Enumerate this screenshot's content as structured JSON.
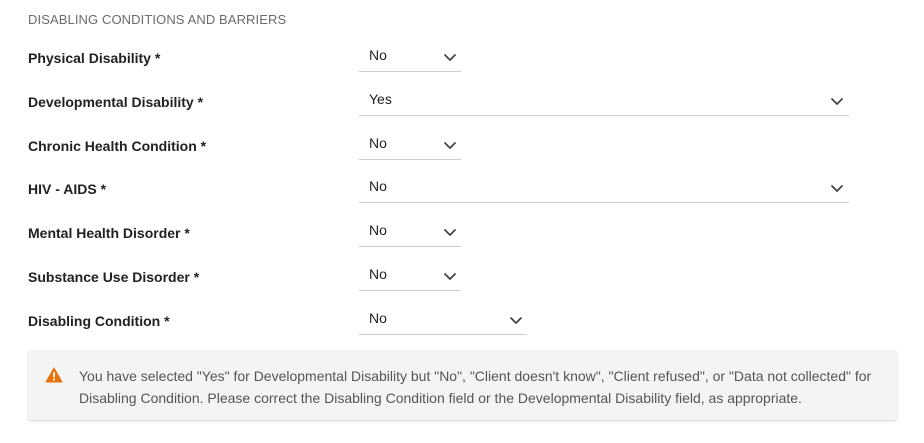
{
  "section": {
    "title": "DISABLING CONDITIONS AND BARRIERS"
  },
  "fields": [
    {
      "label": "Physical Disability *",
      "value": "No"
    },
    {
      "label": "Developmental Disability *",
      "value": "Yes"
    },
    {
      "label": "Chronic Health Condition *",
      "value": "No"
    },
    {
      "label": "HIV - AIDS *",
      "value": "No"
    },
    {
      "label": "Mental Health Disorder *",
      "value": "No"
    },
    {
      "label": "Substance Use Disorder *",
      "value": "No"
    },
    {
      "label": "Disabling Condition *",
      "value": "No"
    }
  ],
  "alert": {
    "icon": "warning-icon",
    "color": "#e8730c",
    "message": "You have selected \"Yes\" for Developmental Disability but \"No\", \"Client doesn't know\", \"Client refused\", or \"Data not collected\" for Disabling Condition. Please correct the Disabling Condition field or the Developmental Disability field, as appropriate."
  }
}
